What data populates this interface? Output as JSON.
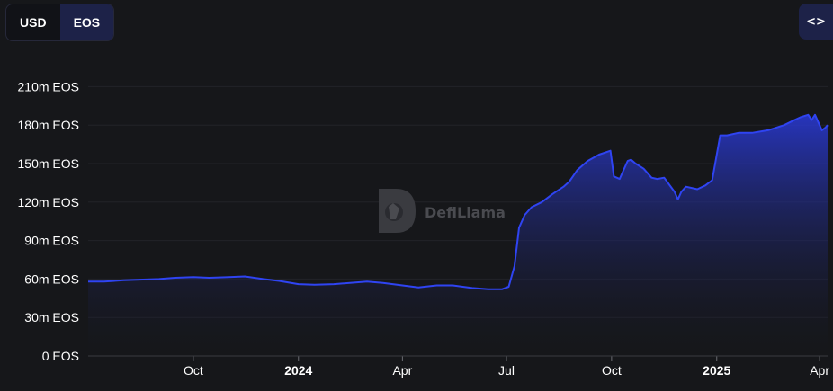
{
  "toolbar": {
    "denom_options": [
      "USD",
      "EOS"
    ],
    "active_denom": "EOS",
    "embed_label": "<>"
  },
  "watermark": {
    "text": "DefiLlama"
  },
  "colors": {
    "line": "#2f44f2",
    "fill_top": "#2a3ad9",
    "grid": "#222328",
    "background": "#16171a"
  },
  "chart_data": {
    "type": "area",
    "title": "",
    "xlabel": "",
    "ylabel": "",
    "ylim": [
      0,
      225
    ],
    "y_unit": "m EOS",
    "y_ticks": [
      0,
      30,
      60,
      90,
      120,
      150,
      180,
      210
    ],
    "y_tick_labels": [
      "0 EOS",
      "30m EOS",
      "60m EOS",
      "90m EOS",
      "120m EOS",
      "150m EOS",
      "180m EOS",
      "210m EOS"
    ],
    "xlim": [
      "2023-07-01",
      "2025-04-08"
    ],
    "x_ticks": [
      {
        "date": "2023-10-01",
        "label": "Oct",
        "bold": false
      },
      {
        "date": "2024-01-01",
        "label": "2024",
        "bold": true
      },
      {
        "date": "2024-04-01",
        "label": "Apr",
        "bold": false
      },
      {
        "date": "2024-07-01",
        "label": "Jul",
        "bold": false
      },
      {
        "date": "2024-10-01",
        "label": "Oct",
        "bold": false
      },
      {
        "date": "2025-01-01",
        "label": "2025",
        "bold": true
      },
      {
        "date": "2025-04-01",
        "label": "Apr",
        "bold": false
      }
    ],
    "grid": true,
    "series": [
      {
        "x": [
          "2023-07-01",
          "2023-07-15",
          "2023-08-01",
          "2023-08-15",
          "2023-09-01",
          "2023-09-15",
          "2023-10-01",
          "2023-10-15",
          "2023-11-01",
          "2023-11-15",
          "2023-12-01",
          "2023-12-15",
          "2024-01-01",
          "2024-01-15",
          "2024-02-01",
          "2024-02-15",
          "2024-03-01",
          "2024-03-15",
          "2024-04-01",
          "2024-04-15",
          "2024-05-01",
          "2024-05-15",
          "2024-06-01",
          "2024-06-15",
          "2024-06-27",
          "2024-07-03",
          "2024-07-08",
          "2024-07-12",
          "2024-07-17",
          "2024-07-23",
          "2024-08-01",
          "2024-08-10",
          "2024-08-20",
          "2024-08-25",
          "2024-09-01",
          "2024-09-10",
          "2024-09-20",
          "2024-09-30",
          "2024-10-03",
          "2024-10-08",
          "2024-10-15",
          "2024-10-18",
          "2024-10-22",
          "2024-10-29",
          "2024-11-05",
          "2024-11-10",
          "2024-11-16",
          "2024-11-25",
          "2024-11-28",
          "2024-12-01",
          "2024-12-05",
          "2024-12-15",
          "2024-12-22",
          "2024-12-28",
          "2025-01-04",
          "2025-01-10",
          "2025-01-20",
          "2025-02-01",
          "2025-02-15",
          "2025-03-01",
          "2025-03-10",
          "2025-03-15",
          "2025-03-22",
          "2025-03-25",
          "2025-03-28",
          "2025-04-03",
          "2025-04-06",
          "2025-04-08"
        ],
        "values": [
          58,
          58,
          59,
          59.5,
          60,
          61,
          61.5,
          61,
          61.5,
          62,
          60,
          58.5,
          56,
          55.5,
          56,
          57,
          58,
          57,
          55,
          53.5,
          55,
          55,
          53,
          52,
          52,
          54,
          70,
          100,
          110,
          116,
          120,
          126,
          132,
          136,
          145,
          152,
          157,
          160,
          140,
          138,
          152,
          153,
          150,
          146,
          139,
          138,
          139,
          128,
          122,
          128,
          132,
          130,
          133,
          137,
          172,
          172,
          174,
          174,
          176,
          180,
          184,
          186,
          188,
          184,
          188,
          176,
          178,
          180
        ]
      }
    ]
  }
}
